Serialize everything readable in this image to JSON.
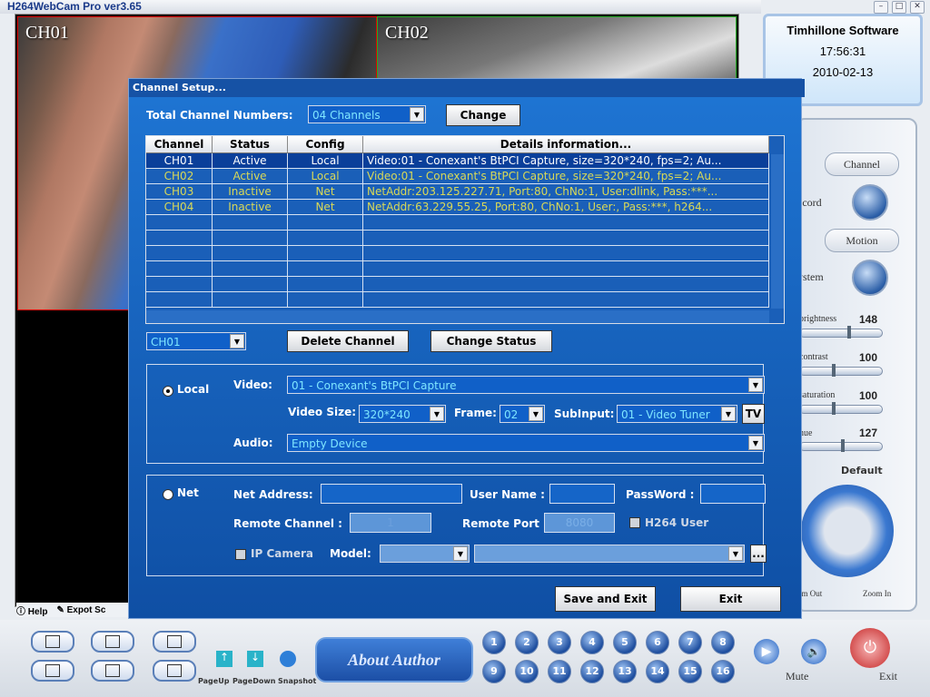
{
  "window": {
    "title": "H264WebCam Pro ver3.65"
  },
  "tiles": [
    {
      "label": "CH01"
    },
    {
      "label": "CH02"
    }
  ],
  "help": {
    "help_label": "Help",
    "export_label": "Expot Sc"
  },
  "info": {
    "company": "Timhillone Software",
    "time": "17:56:31",
    "date": "2010-02-13"
  },
  "right_panel": {
    "channel": "Channel",
    "record": "ecord",
    "motion": "Motion",
    "system": "ystem",
    "sliders": [
      {
        "label": "brightness",
        "value": "148"
      },
      {
        "label": "contrast",
        "value": "100"
      },
      {
        "label": "saturation",
        "value": "100"
      },
      {
        "label": "hue",
        "value": "127"
      }
    ],
    "default": "Default",
    "zoom_out": "om Out",
    "zoom_in": "Zoom In"
  },
  "bottom": {
    "about": "About  Author",
    "pageup": "PageUp",
    "pagedown": "PageDown",
    "snapshot": "Snapshot",
    "numbers": [
      "1",
      "2",
      "3",
      "4",
      "5",
      "6",
      "7",
      "8",
      "9",
      "10",
      "11",
      "12",
      "13",
      "14",
      "15",
      "16"
    ],
    "mute": "Mute",
    "exit": "Exit"
  },
  "dialog": {
    "title": "Channel Setup...",
    "total_label": "Total Channel Numbers:",
    "total_value": "04 Channels",
    "change": "Change",
    "columns": [
      "Channel",
      "Status",
      "Config",
      "Details information..."
    ],
    "rows": [
      {
        "channel": "CH01",
        "status": "Active",
        "config": "Local",
        "details": "Video:01 - Conexant's BtPCI Capture, size=320*240, fps=2;  Au..."
      },
      {
        "channel": "CH02",
        "status": "Active",
        "config": "Local",
        "details": "Video:01 - Conexant's BtPCI Capture, size=320*240, fps=2;  Au..."
      },
      {
        "channel": "CH03",
        "status": "Inactive",
        "config": "Net",
        "details": "NetAddr:203.125.227.71, Port:80, ChNo:1, User:dlink, Pass:***..."
      },
      {
        "channel": "CH04",
        "status": "Inactive",
        "config": "Net",
        "details": "NetAddr:63.229.55.25, Port:80, ChNo:1, User:, Pass:***, h264..."
      }
    ],
    "selected_channel": "CH01",
    "delete": "Delete Channel",
    "change_status": "Change Status",
    "local": {
      "label": "Local",
      "video_label": "Video:",
      "video": "01 - Conexant's BtPCI Capture",
      "size_label": "Video Size:",
      "size": "320*240",
      "frame_label": "Frame:",
      "frame": "02",
      "subinput_label": "SubInput:",
      "subinput": "01 - Video Tuner",
      "tv": "TV",
      "audio_label": "Audio:",
      "audio": "Empty Device"
    },
    "net": {
      "label": "Net",
      "address_label": "Net Address:",
      "user_label": "User Name :",
      "password_label": "PassWord :",
      "remote_channel_label": "Remote Channel :",
      "remote_channel": "1",
      "remote_port_label": "Remote Port :",
      "remote_port": "8080",
      "h264_user": "H264 User",
      "ip_camera": "IP Camera",
      "model_label": "Model:",
      "dots": "..."
    },
    "save_exit": "Save and Exit",
    "exit": "Exit"
  }
}
